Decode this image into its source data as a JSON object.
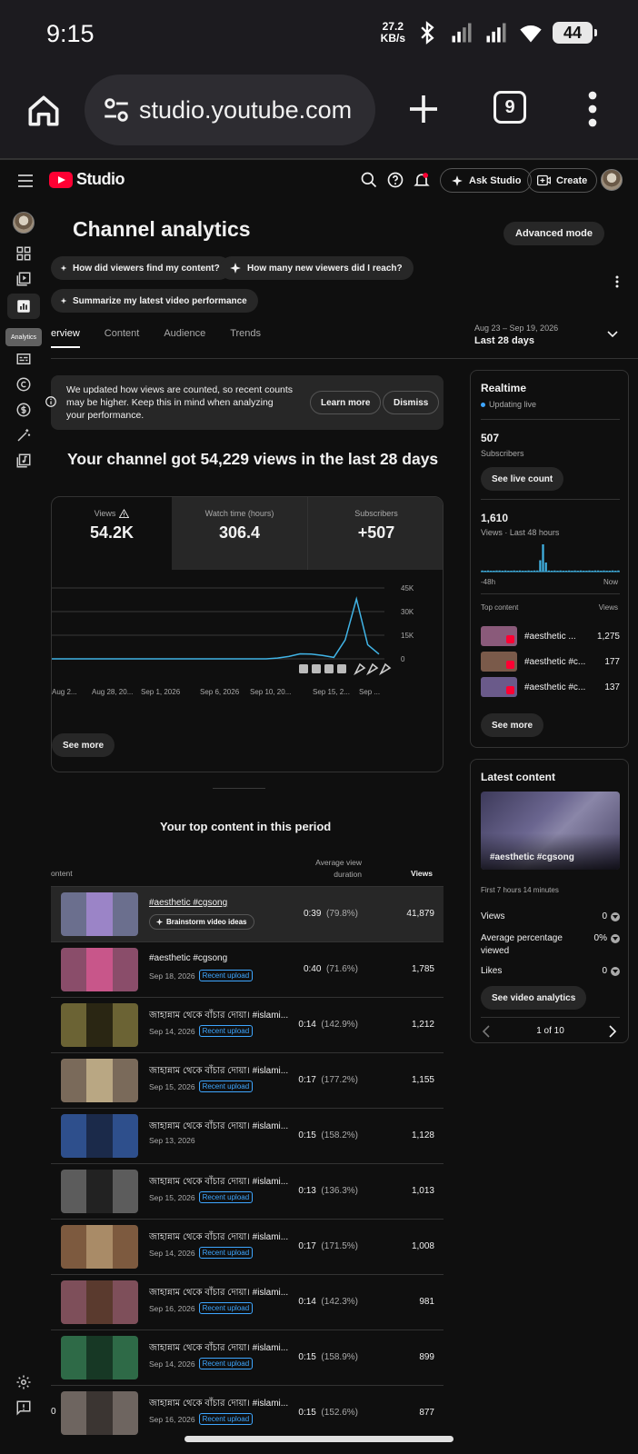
{
  "status_bar": {
    "time": "9:15",
    "net_speed_value": "27.2",
    "net_speed_unit": "KB/s",
    "battery": "44"
  },
  "browser": {
    "url": "studio.youtube.com",
    "tab_count": "9"
  },
  "studio": {
    "logo_text": "Studio",
    "ask_studio": "Ask Studio",
    "create": "Create",
    "rail_tooltip": "Analytics"
  },
  "page": {
    "title": "Channel analytics",
    "advanced_mode": "Advanced mode",
    "chips": [
      "How did viewers find my content?",
      "How many new viewers did I reach?",
      "Summarize my latest video performance"
    ],
    "tabs": [
      "erview",
      "Content",
      "Audience",
      "Trends"
    ],
    "date_range": {
      "range": "Aug 23 – Sep 19, 2026",
      "label": "Last 28 days"
    }
  },
  "notice": {
    "text": "We updated how views are counted, so recent counts may be higher. Keep this in mind when analyzing your performance.",
    "learn_more": "Learn more",
    "dismiss": "Dismiss"
  },
  "headline": "Your channel got 54,229 views in the last 28 days",
  "stats": [
    {
      "label": "Views",
      "value": "54.2K",
      "warning": true
    },
    {
      "label": "Watch time (hours)",
      "value": "306.4",
      "warning": false
    },
    {
      "label": "Subscribers",
      "value": "+507",
      "warning": false
    }
  ],
  "chart_data": {
    "type": "line",
    "series": [
      {
        "values": [
          0,
          0,
          0,
          0,
          0,
          0,
          0,
          0,
          0,
          0,
          0,
          0,
          0,
          0,
          0,
          0,
          0,
          0,
          0,
          0,
          500,
          1500,
          3200,
          3000,
          2200,
          900,
          12000,
          38000,
          9000,
          3000
        ]
      }
    ],
    "x_tick_labels": [
      "Aug 2...",
      "Aug 28, 20...",
      "Sep 1, 2026",
      "Sep 6, 2026",
      "Sep 10, 20...",
      "Sep 15, 2...",
      "Sep ..."
    ],
    "y_tick_labels": [
      "45K",
      "30K",
      "15K",
      "0"
    ],
    "ylim": [
      0,
      45000
    ],
    "color": "#41b4e6"
  },
  "see_more": "See more",
  "top_content": {
    "title": "Your top content in this period",
    "col_content": "ontent",
    "col_avg": "Average view duration",
    "col_views": "Views",
    "rows": [
      {
        "title": "#aesthetic #cgsong",
        "date": "",
        "badge": "",
        "extra": "Brainstorm video ideas",
        "avg": "0:39",
        "pct": "(79.8%)",
        "views": "41,879",
        "color": "#6b6f8e",
        "inner": "#9b84c7"
      },
      {
        "title": "#aesthetic #cgsong",
        "date": "Sep 18, 2026",
        "badge": "Recent upload",
        "extra": "",
        "avg": "0:40",
        "pct": "(71.6%)",
        "views": "1,785",
        "color": "#8a4d6a",
        "inner": "#c8568a"
      },
      {
        "title": "জাহান্নাম থেকে বাঁচার দোয়া। #islami...",
        "date": "Sep 14, 2026",
        "badge": "Recent upload",
        "extra": "",
        "avg": "0:14",
        "pct": "(142.9%)",
        "views": "1,212",
        "color": "#6b6334",
        "inner": "#2a2613"
      },
      {
        "title": "জাহান্নাম থেকে বাঁচার দোয়া। #islami...",
        "date": "Sep 15, 2026",
        "badge": "Recent upload",
        "extra": "",
        "avg": "0:17",
        "pct": "(177.2%)",
        "views": "1,155",
        "color": "#7a6a5a",
        "inner": "#b9a783"
      },
      {
        "title": "জাহান্নাম থেকে বাঁচার দোয়া। #islami...",
        "date": "Sep 13, 2026",
        "badge": "",
        "extra": "",
        "avg": "0:15",
        "pct": "(158.2%)",
        "views": "1,128",
        "color": "#2e4f8c",
        "inner": "#1b2a4a"
      },
      {
        "title": "জাহান্নাম থেকে বাঁচার দোয়া। #islami...",
        "date": "Sep 15, 2026",
        "badge": "Recent upload",
        "extra": "",
        "avg": "0:13",
        "pct": "(136.3%)",
        "views": "1,013",
        "color": "#5c5c5c",
        "inner": "#222222"
      },
      {
        "title": "জাহান্নাম থেকে বাঁচার দোয়া। #islami...",
        "date": "Sep 14, 2026",
        "badge": "Recent upload",
        "extra": "",
        "avg": "0:17",
        "pct": "(171.5%)",
        "views": "1,008",
        "color": "#7d5a3f",
        "inner": "#a98b67"
      },
      {
        "title": "জাহান্নাম থেকে বাঁচার দোয়া। #islami...",
        "date": "Sep 16, 2026",
        "badge": "Recent upload",
        "extra": "",
        "avg": "0:14",
        "pct": "(142.3%)",
        "views": "981",
        "color": "#7e4f5a",
        "inner": "#5a3a2e"
      },
      {
        "title": "জাহান্নাম থেকে বাঁচার দোয়া। #islami...",
        "date": "Sep 14, 2026",
        "badge": "Recent upload",
        "extra": "",
        "avg": "0:15",
        "pct": "(158.9%)",
        "views": "899",
        "color": "#2e6a47",
        "inner": "#173825"
      },
      {
        "title": "জাহান্নাম থেকে বাঁচার দোয়া। #islami...",
        "date": "Sep 16, 2026",
        "badge": "Recent upload",
        "extra": "",
        "avg": "0:15",
        "pct": "(152.6%)",
        "views": "877",
        "color": "#6e6560",
        "inner": "#3b3532"
      }
    ],
    "last_row_rank": "0"
  },
  "realtime": {
    "title": "Realtime",
    "status": "Updating live",
    "subs_value": "507",
    "subs_label": "Subscribers",
    "see_live": "See live count",
    "views_value": "1,610",
    "views_label": "Views · Last 48 hours",
    "axis_left": "-48h",
    "axis_right": "Now",
    "spark_values": [
      1,
      0,
      1,
      0,
      0,
      1,
      1,
      0,
      1,
      0,
      0,
      1,
      0,
      1,
      0,
      0,
      1,
      0,
      1,
      1,
      10,
      24,
      8,
      1,
      0,
      1,
      0,
      1,
      0,
      0,
      1,
      0,
      1,
      0,
      1,
      0,
      0,
      1,
      0,
      1,
      1,
      0,
      1,
      0,
      0,
      1,
      0,
      1
    ],
    "top_content_label": "Top content",
    "views_col": "Views",
    "items": [
      {
        "title": "#aesthetic ...",
        "views": "1,275",
        "color": "#8a5a7a"
      },
      {
        "title": "#aesthetic #c...",
        "views": "177",
        "color": "#7a5a4a"
      },
      {
        "title": "#aesthetic #c...",
        "views": "137",
        "color": "#6a5a8a"
      }
    ],
    "see_more": "See more"
  },
  "latest": {
    "title": "Latest content",
    "video_title": "#aesthetic #cgsong",
    "first_period": "First 7 hours 14 minutes",
    "rows": [
      {
        "label": "Views",
        "value": "0"
      },
      {
        "label": "Average percentage viewed",
        "value": "0%"
      },
      {
        "label": "Likes",
        "value": "0"
      }
    ],
    "see_analytics": "See video analytics",
    "pager": "1 of 10"
  }
}
